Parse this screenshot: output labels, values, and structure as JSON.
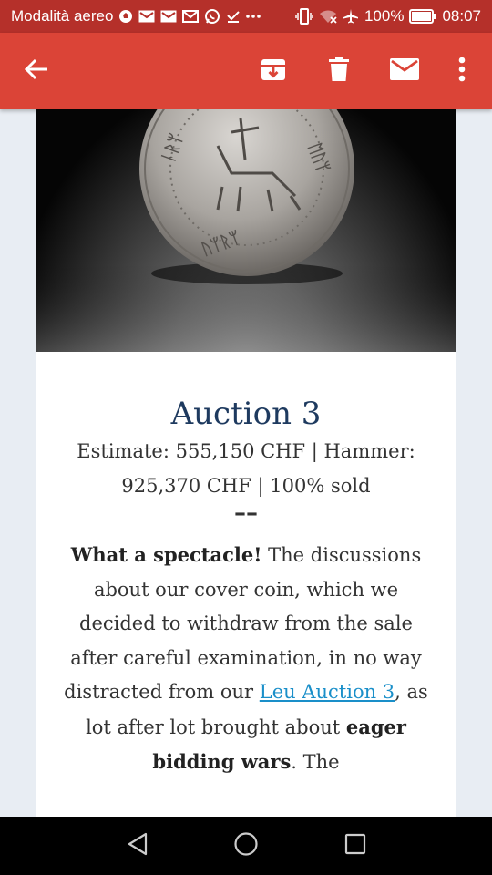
{
  "status_bar": {
    "carrier": "Modalità aereo",
    "battery": "100%",
    "time": "08:07"
  },
  "app_bar": {
    "icons": [
      "back-arrow-icon",
      "archive-icon",
      "delete-icon",
      "mail-icon",
      "more-vert-icon"
    ]
  },
  "email": {
    "title": "Auction 3",
    "meta_line1": "Estimate: 555,150 CHF | Hammer:",
    "meta_line2": "925,370 CHF | 100% sold",
    "divider": "––",
    "lead_bold": "What a spectacle!",
    "para_1": " The discussions about our cover coin, which we decided to withdraw from the sale after careful examination, in no way distracted from our ",
    "link_text": "Leu Auction 3",
    "para_2": ", as lot after lot brought about ",
    "bold_2": "eager bidding wars",
    "para_3": ". The"
  },
  "colors": {
    "status_bar": "#b5302a",
    "app_bar": "#db4437",
    "title": "#1e3a5f",
    "link": "#1a8fc9"
  }
}
